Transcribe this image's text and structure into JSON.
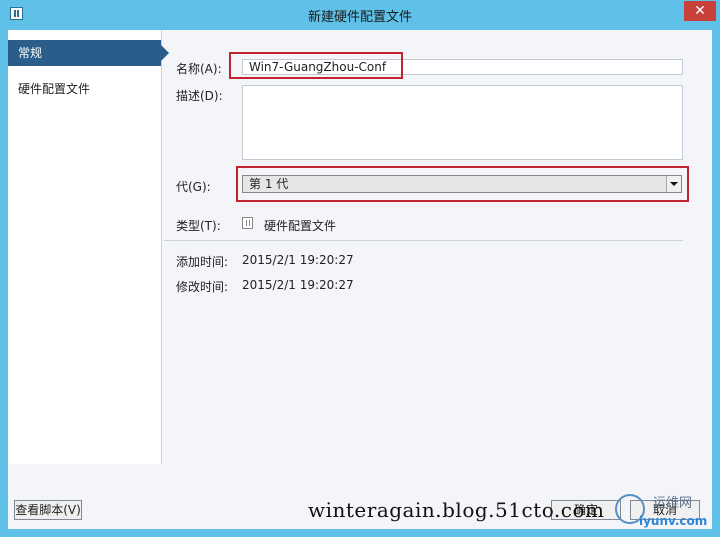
{
  "window": {
    "title": "新建硬件配置文件",
    "close_glyph": "✕"
  },
  "sidebar": {
    "items": [
      {
        "label": "常规"
      },
      {
        "label": "硬件配置文件"
      }
    ]
  },
  "form": {
    "name_label": "名称(A):",
    "name_value": "Win7-GuangZhou-Conf",
    "desc_label": "描述(D):",
    "desc_value": "",
    "gen_label": "代(G):",
    "gen_value": "第 1 代",
    "type_label": "类型(T):",
    "type_value": "硬件配置文件",
    "added_label": "添加时间:",
    "added_value": "2015/2/1 19:20:27",
    "modified_label": "修改时间:",
    "modified_value": "2015/2/1 19:20:27"
  },
  "footer": {
    "view_script": "查看脚本(V)",
    "ok": "确定",
    "cancel": "取消"
  },
  "watermark": {
    "text": "winteragain.blog.51cto.com",
    "logo_cn": "运维网",
    "logo_url": "iyunv.com"
  },
  "colors": {
    "titlebar": "#5fc1e8",
    "nav_active": "#2b5d8b",
    "highlight": "#c0252f",
    "close": "#c7403a"
  }
}
